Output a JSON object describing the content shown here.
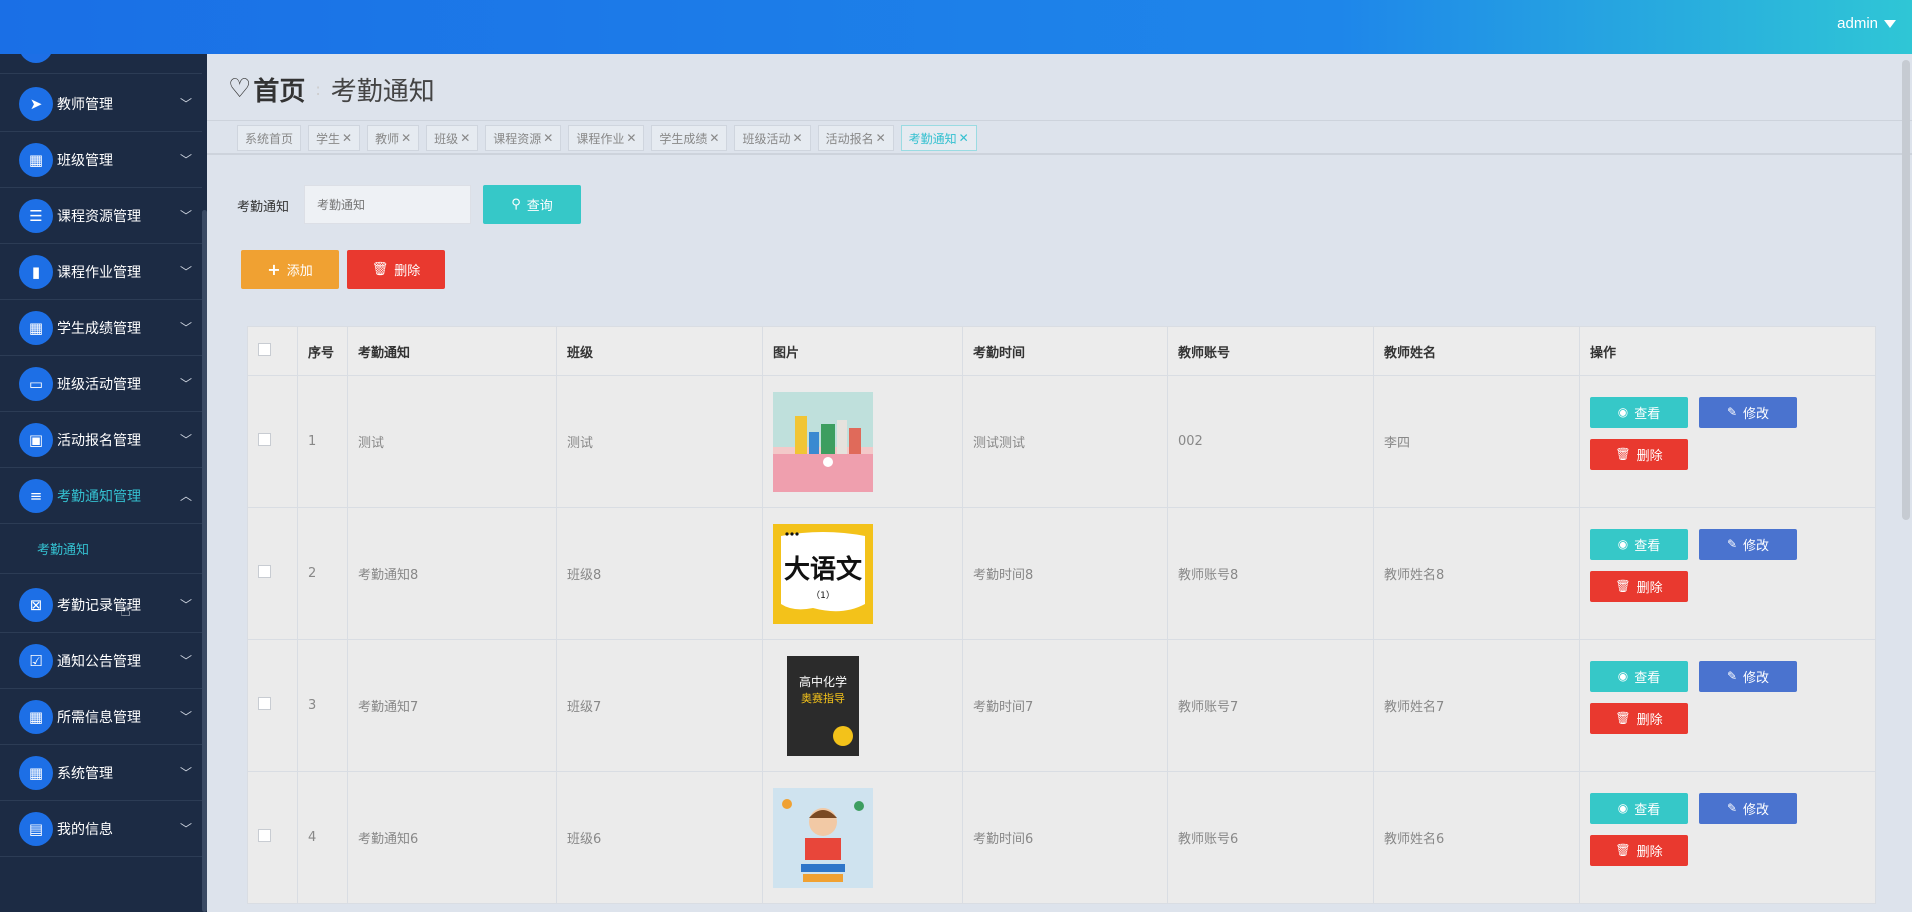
{
  "header": {
    "user": "admin"
  },
  "sidebar": {
    "items": [
      {
        "label": "教师管理",
        "icon": "paper-plane-icon",
        "glyph": "➤"
      },
      {
        "label": "班级管理",
        "icon": "grid-icon",
        "glyph": "▦"
      },
      {
        "label": "课程资源管理",
        "icon": "sliders-icon",
        "glyph": "☰"
      },
      {
        "label": "课程作业管理",
        "icon": "book-icon",
        "glyph": "▮"
      },
      {
        "label": "学生成绩管理",
        "icon": "apps-icon",
        "glyph": "▦"
      },
      {
        "label": "班级活动管理",
        "icon": "ticket-icon",
        "glyph": "▭"
      },
      {
        "label": "活动报名管理",
        "icon": "chart-icon",
        "glyph": "▣"
      },
      {
        "label": "考勤通知管理",
        "icon": "list-icon",
        "glyph": "≡"
      },
      {
        "label": "考勤记录管理",
        "icon": "clipboard-x-icon",
        "glyph": "⊠"
      },
      {
        "label": "通知公告管理",
        "icon": "clipboard-check-icon",
        "glyph": "☑"
      },
      {
        "label": "所需信息管理",
        "icon": "apps-icon",
        "glyph": "▦"
      },
      {
        "label": "系统管理",
        "icon": "apps-icon",
        "glyph": "▦"
      },
      {
        "label": "我的信息",
        "icon": "id-card-icon",
        "glyph": "▤"
      }
    ],
    "sub_item": "考勤通知"
  },
  "breadcrumb": {
    "home": "首页",
    "current": "考勤通知"
  },
  "tabs": [
    "系统首页",
    "学生",
    "教师",
    "班级",
    "课程资源",
    "课程作业",
    "学生成绩",
    "班级活动",
    "活动报名",
    "考勤通知"
  ],
  "search": {
    "label": "考勤通知",
    "placeholder": "考勤通知",
    "query_btn": "查询"
  },
  "actions": {
    "add": "添加",
    "delete": "删除"
  },
  "table": {
    "headers": [
      "序号",
      "考勤通知",
      "班级",
      "图片",
      "考勤时间",
      "教师账号",
      "教师姓名",
      "操作"
    ],
    "rows": [
      {
        "no": "1",
        "notice": "测试",
        "class": "测试",
        "time": "测试测试",
        "account": "002",
        "name": "李四"
      },
      {
        "no": "2",
        "notice": "考勤通知8",
        "class": "班级8",
        "time": "考勤时间8",
        "account": "教师账号8",
        "name": "教师姓名8"
      },
      {
        "no": "3",
        "notice": "考勤通知7",
        "class": "班级7",
        "time": "考勤时间7",
        "account": "教师账号7",
        "name": "教师姓名7"
      },
      {
        "no": "4",
        "notice": "考勤通知6",
        "class": "班级6",
        "time": "考勤时间6",
        "account": "教师账号6",
        "name": "教师姓名6"
      }
    ],
    "row_actions": {
      "view": "查看",
      "edit": "修改",
      "delete": "删除"
    }
  },
  "thumb_texts": {
    "chinese_book": "大语文",
    "chinese_book_sub": "（1）",
    "chem_title": "高中化学",
    "chem_sub": "奥赛指导"
  },
  "colors": {
    "accent": "#36c8c8",
    "primary": "#1d6fe6",
    "danger": "#e9392f",
    "warning": "#f0a132",
    "edit": "#4a73cf"
  }
}
